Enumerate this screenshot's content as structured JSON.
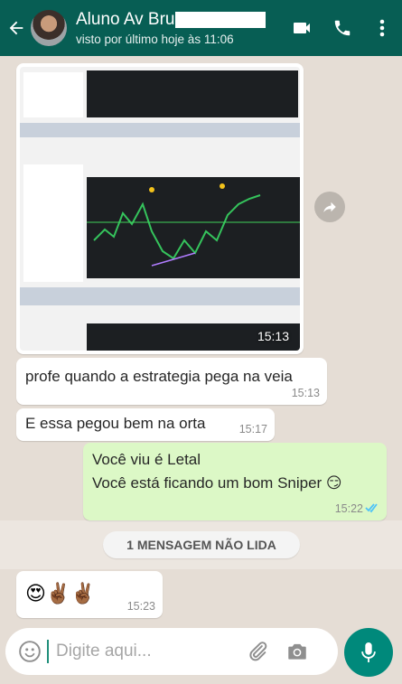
{
  "header": {
    "contact_name": "Aluno Av Bru",
    "status": "visto por último hoje às 11:06",
    "icons": [
      "back-arrow-icon",
      "video-call-icon",
      "phone-icon",
      "more-options-icon"
    ]
  },
  "messages": [
    {
      "type": "image",
      "direction": "in",
      "time": "15:13"
    },
    {
      "type": "text",
      "direction": "in",
      "text": "profe quando a estrategia pega na veia",
      "time": "15:13"
    },
    {
      "type": "text",
      "direction": "in",
      "text": "E essa pegou bem na orta",
      "time": "15:17"
    },
    {
      "type": "text",
      "direction": "out",
      "lines": [
        "Você viu é Letal",
        "Você está ficando um bom Sniper 😏"
      ],
      "time": "15:22",
      "status": "read"
    },
    {
      "type": "emoji",
      "direction": "in",
      "text": "😍✌🏾✌🏾",
      "time": "15:23"
    }
  ],
  "unread_divider": "1 MENSAGEM NÃO LIDA",
  "composer": {
    "placeholder": "Digite aqui...",
    "icons": [
      "emoji-icon",
      "attach-icon",
      "camera-icon",
      "mic-icon"
    ]
  },
  "colors": {
    "header": "#075e54",
    "outgoing_bubble": "#dcf8c6",
    "incoming_bubble": "#ffffff",
    "accent": "#00897b",
    "read_ticks": "#4fc3f7"
  }
}
